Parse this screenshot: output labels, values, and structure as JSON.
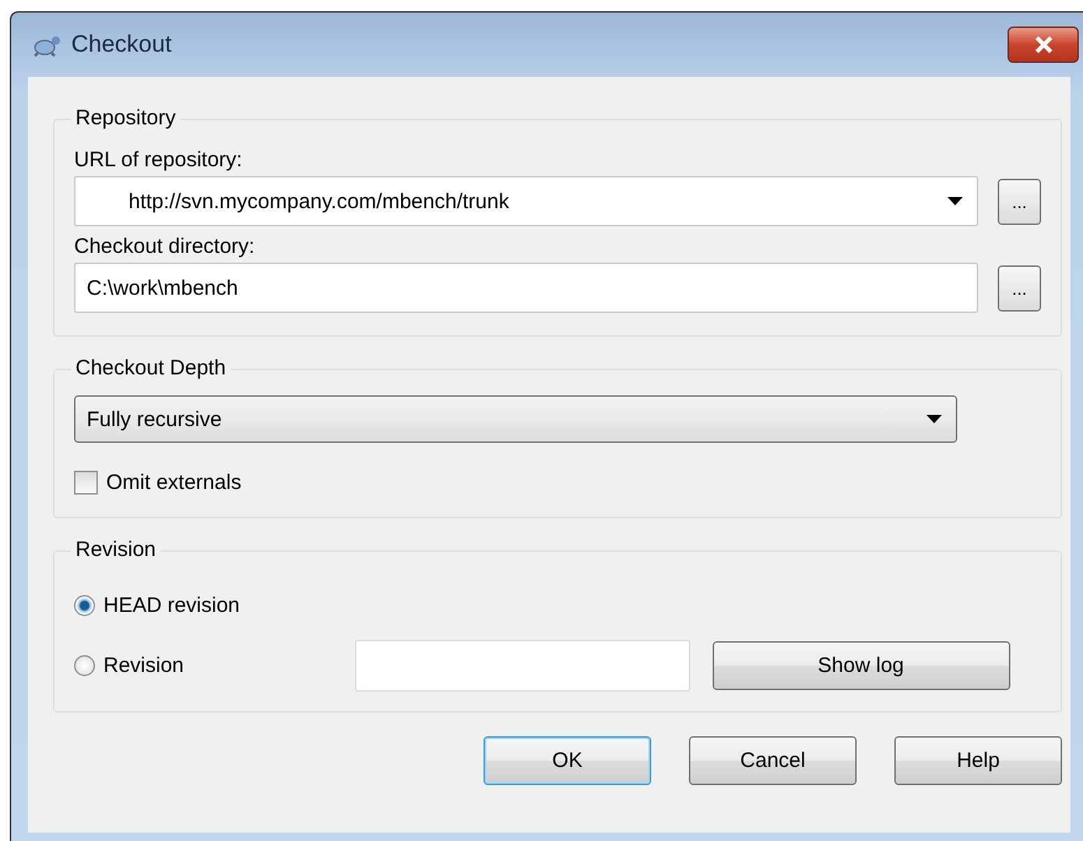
{
  "window": {
    "title": "Checkout"
  },
  "repository": {
    "title": "Repository",
    "fields": [
      {
        "kind": "combo",
        "label": "URL of repository:",
        "value": "http://svn.mycompany.com/mbench/trunk",
        "browse": "..."
      },
      {
        "kind": "text",
        "label": "Checkout directory:",
        "value": "C:\\work\\mbench",
        "browse": "..."
      }
    ]
  },
  "depth": {
    "title": "Checkout Depth",
    "value": "Fully recursive",
    "omit_externals": {
      "label": "Omit externals",
      "checked": false
    }
  },
  "revision": {
    "title": "Revision",
    "options": [
      {
        "label": "HEAD revision",
        "selected": true
      },
      {
        "label": "Revision",
        "selected": false
      }
    ],
    "show_log": "Show log"
  },
  "buttons": [
    {
      "label": "OK",
      "default": true
    },
    {
      "label": "Cancel",
      "default": false
    },
    {
      "label": "Help",
      "default": false
    }
  ]
}
